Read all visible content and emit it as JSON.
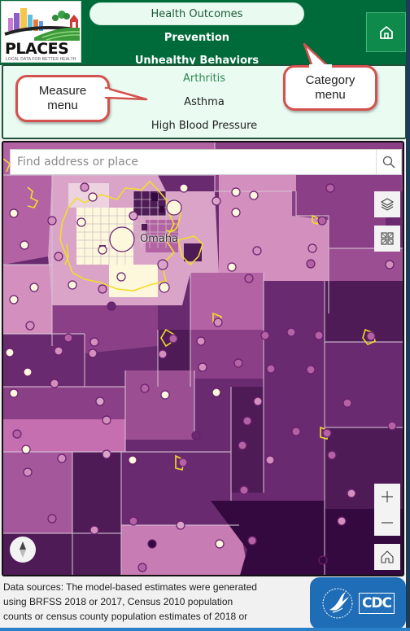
{
  "logo": {
    "wordmark": "PLACES",
    "tagline": "LOCAL DATA FOR BETTER HEALTH"
  },
  "category_menu": {
    "items": [
      {
        "label": "Health Outcomes",
        "active": true
      },
      {
        "label": "Prevention",
        "active": false
      },
      {
        "label": "Unhealthy Behaviors",
        "active": false
      }
    ]
  },
  "home_button": {
    "icon": "home-icon"
  },
  "measure_menu": {
    "items": [
      {
        "label": "Arthritis",
        "selected": true
      },
      {
        "label": "Asthma",
        "selected": false
      },
      {
        "label": "High Blood Pressure",
        "selected": false
      }
    ]
  },
  "callouts": {
    "measure": {
      "line1": "Measure",
      "line2": "menu"
    },
    "category": {
      "line1": "Category",
      "line2": "menu"
    }
  },
  "map": {
    "search": {
      "placeholder": "Find address or place",
      "value": ""
    },
    "city_label": "Omaha",
    "controls": {
      "search_icon": "search-icon",
      "layers_icon": "layers-icon",
      "basemap_icon": "basemap-gallery-icon",
      "zoom_in_icon": "plus-icon",
      "zoom_out_icon": "minus-icon",
      "home_icon": "home-icon",
      "compass_icon": "compass-icon"
    },
    "colors": {
      "lightest": "#fdf7dc",
      "light": "#e8c2d8",
      "mid_light": "#d38fbe",
      "mid": "#b363a3",
      "mid_dark": "#8a3f86",
      "dark": "#6a2a6f",
      "darker": "#4e1b57",
      "darkest": "#33093f",
      "city_boundary": "#f2dc2b",
      "county_border": "#d7c4d6"
    }
  },
  "footer": {
    "lines": [
      "Data sources: The model-based estimates were generated",
      "using BRFSS 2018 or 2017, Census 2010 population",
      "counts or census county population estimates of 2018 or"
    ],
    "badge_text": "CDC"
  }
}
